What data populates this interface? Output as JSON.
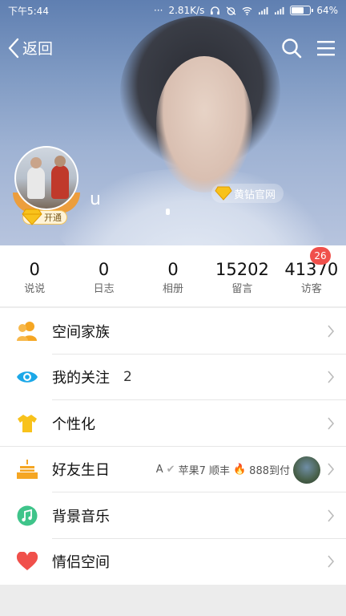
{
  "status_bar": {
    "time": "下午5:44",
    "network_speed": "2.81K/s",
    "battery": "64%",
    "battery_level": 0.64
  },
  "nav": {
    "back_label": "返回",
    "icons": [
      "chevron-left-icon",
      "search-icon",
      "menu-icon"
    ]
  },
  "profile": {
    "username": "u",
    "open_badge": "开通",
    "vip_link": "黄钻官网"
  },
  "stats": [
    {
      "value": "0",
      "label": "说说"
    },
    {
      "value": "0",
      "label": "日志"
    },
    {
      "value": "0",
      "label": "相册"
    },
    {
      "value": "15202",
      "label": "留言"
    },
    {
      "value": "41370",
      "label": "访客",
      "badge": "26"
    }
  ],
  "menu": [
    {
      "label": "空间家族",
      "icon": "family-icon",
      "color": "#f5a623"
    },
    {
      "label": "我的关注",
      "icon": "eye-icon",
      "color": "#1ca8e8",
      "count": "2"
    },
    {
      "label": "个性化",
      "icon": "tshirt-icon",
      "color": "#f8c21b"
    },
    {
      "label": "好友生日",
      "icon": "cake-icon",
      "color": "#f5a623",
      "extra_prefix": "A",
      "extra_text": "苹果7 顺丰",
      "extra_suffix": "888到付"
    },
    {
      "label": "背景音乐",
      "icon": "music-icon",
      "color": "#3fc48a"
    },
    {
      "label": "情侣空间",
      "icon": "heart-icon",
      "color": "#f0504b"
    }
  ],
  "colors": {
    "accent_red": "#f0504b",
    "gold": "#f5a623"
  }
}
